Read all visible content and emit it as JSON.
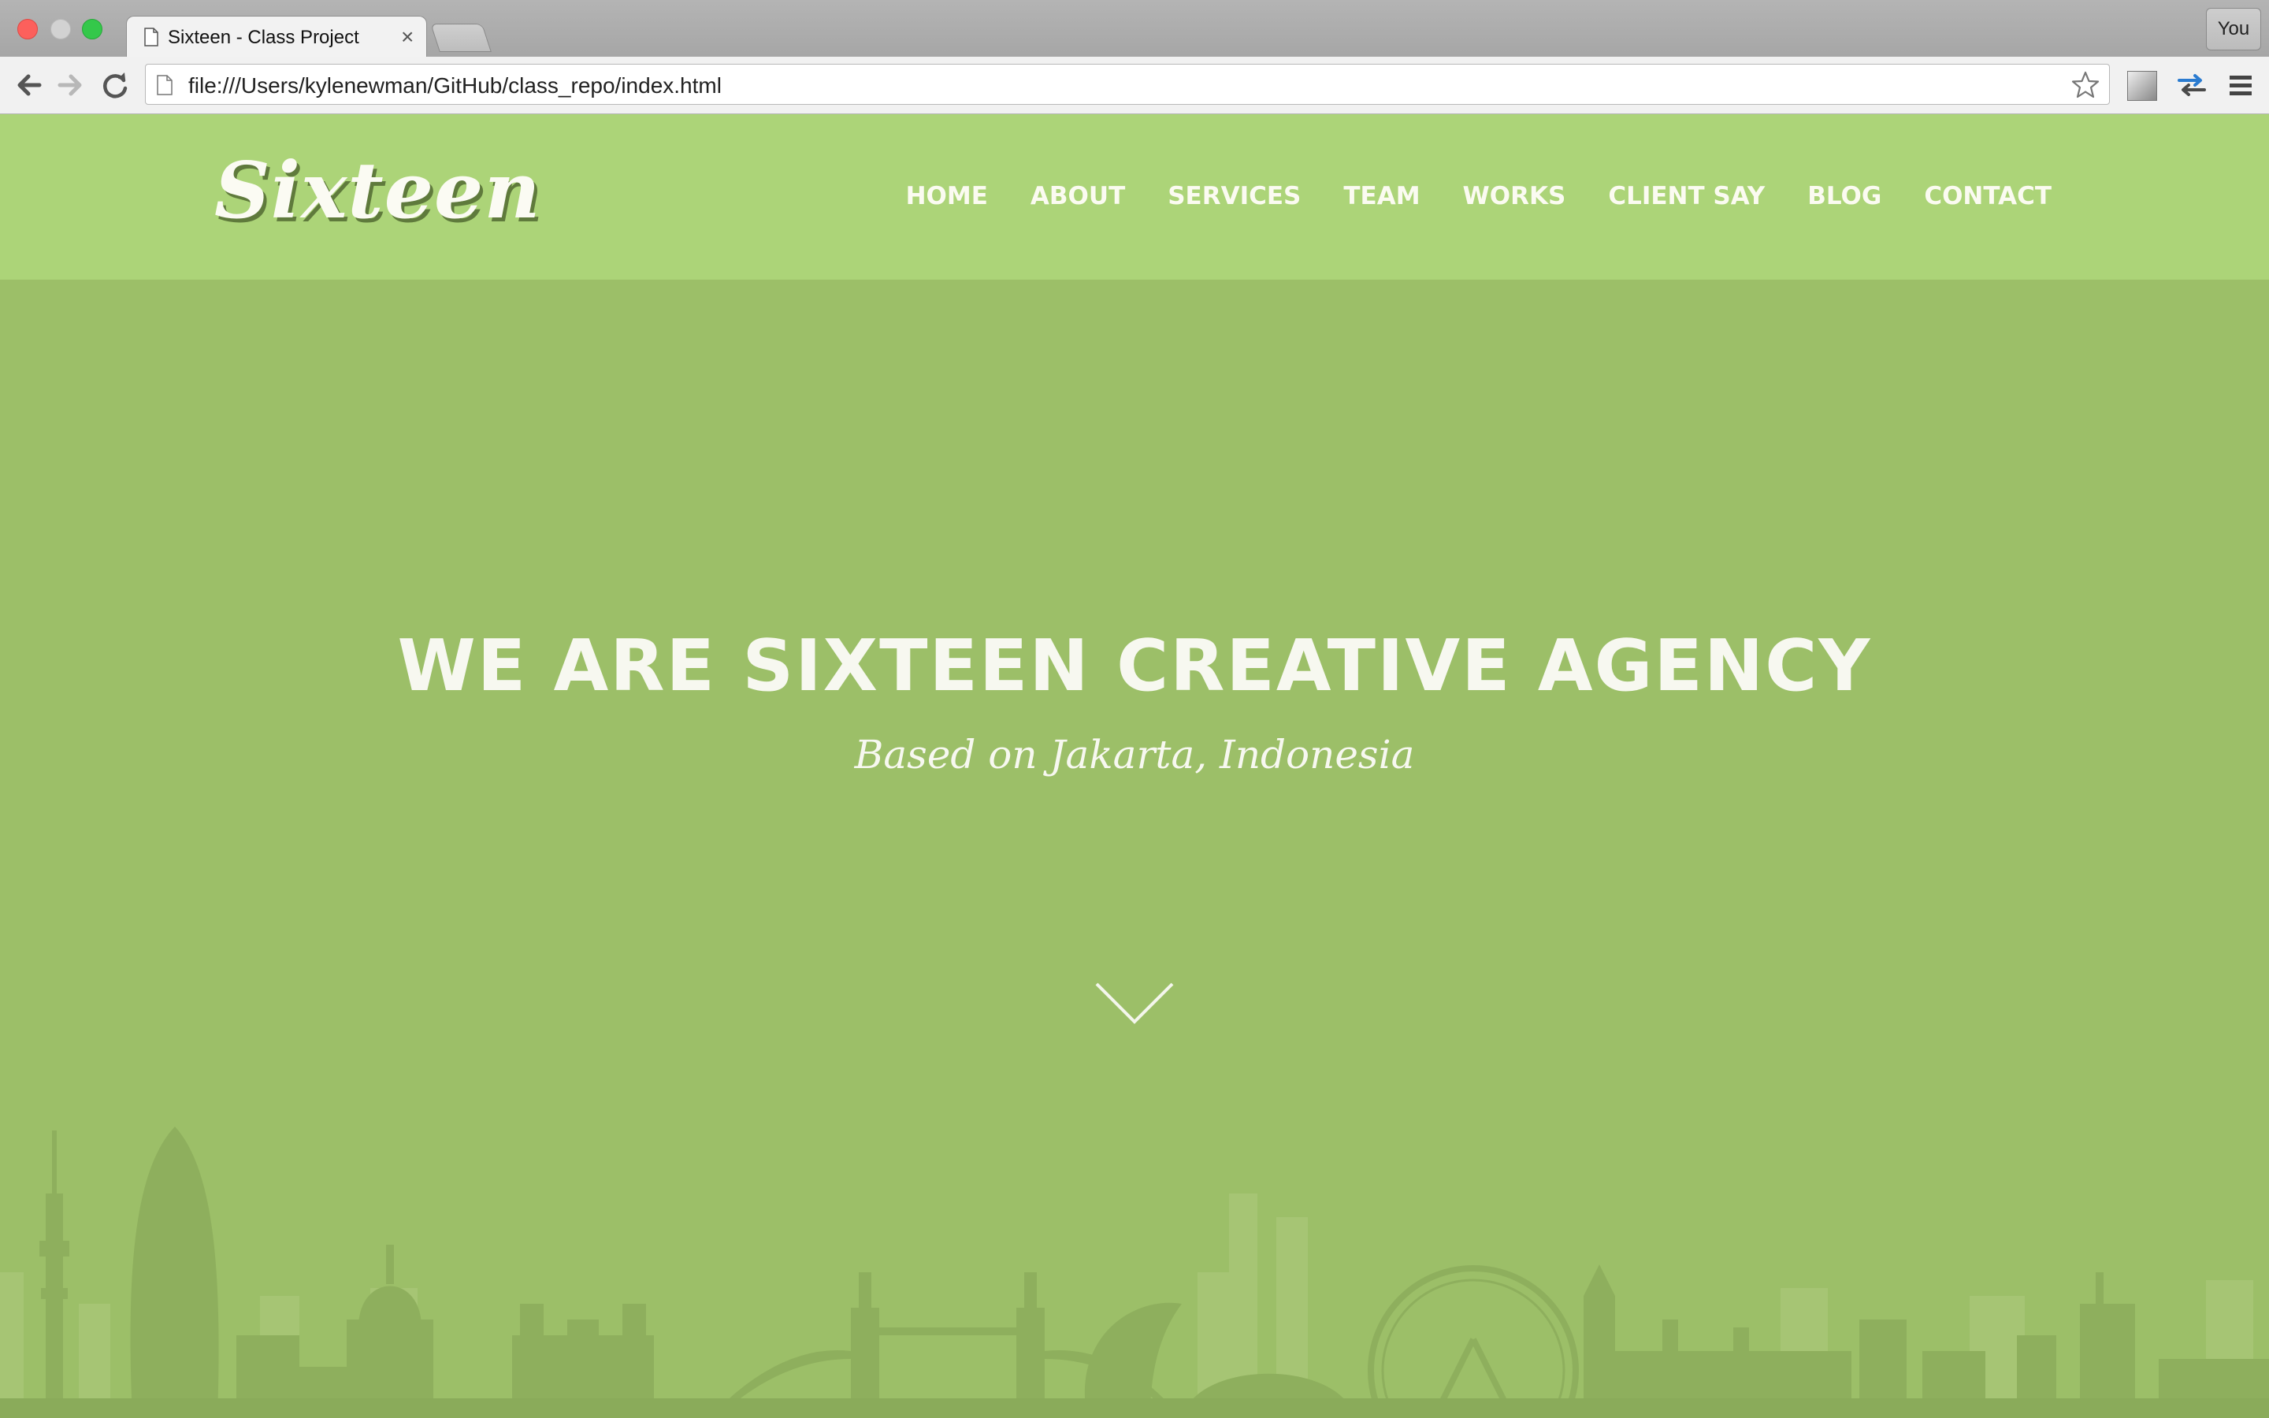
{
  "browser": {
    "tab_title": "Sixteen - Class Project",
    "tab_close": "×",
    "profile_label": "You",
    "url": "file:///Users/kylenewman/GitHub/class_repo/index.html"
  },
  "site": {
    "logo": "Sixteen",
    "nav": [
      "HOME",
      "ABOUT",
      "SERVICES",
      "TEAM",
      "WORKS",
      "CLIENT SAY",
      "BLOG",
      "CONTACT"
    ],
    "hero_title": "WE ARE SIXTEEN CREATIVE AGENCY",
    "hero_subtitle": "Based on Jakarta, Indonesia"
  },
  "colors": {
    "header_bg": "#acd478",
    "hero_bg": "#9cbf68",
    "skyline": "#8aab5a",
    "text": "#f7f8f0"
  },
  "icons": [
    "page-icon",
    "back-arrow-icon",
    "forward-arrow-icon",
    "reload-icon",
    "file-icon",
    "star-icon",
    "extension-icon",
    "sync-icon",
    "menu-icon",
    "chevron-down-icon"
  ]
}
